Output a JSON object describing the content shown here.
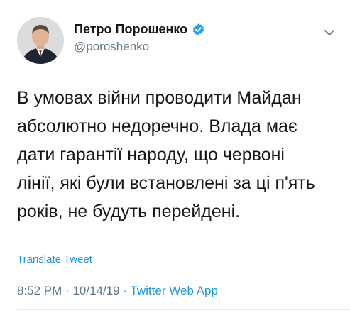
{
  "author": {
    "display_name": "Петро Порошенко",
    "handle": "@poroshenko",
    "verified": true,
    "avatar_icon": "profile-photo"
  },
  "tweet": {
    "text": "В умовах війни проводити Майдан\nабсолютно недоречно. Влада має\nдати гарантії народу, що червоні\nлінії, які були встановлені за ці п'ять\nроків, не будуть перейдені.",
    "translate_label": "Translate Tweet",
    "time": "8:52 PM",
    "date": "10/14/19",
    "separator": "·",
    "source": "Twitter Web App"
  },
  "colors": {
    "link": "#1b95e0",
    "verified_badge": "#1da1f2",
    "secondary_text": "#657786",
    "primary_text": "#14171a"
  }
}
